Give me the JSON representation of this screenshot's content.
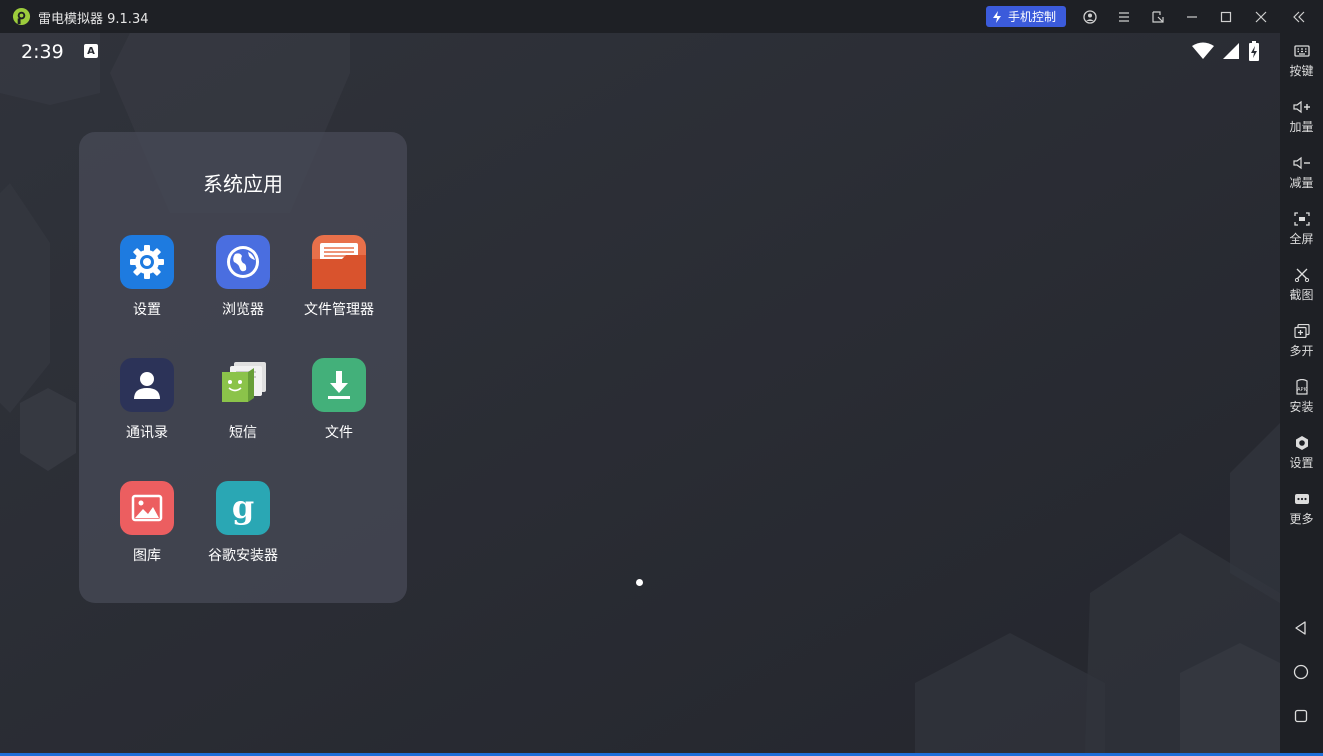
{
  "window": {
    "title": "雷电模拟器 9.1.34",
    "phone_control": "手机控制",
    "accent": "#3b5bdb"
  },
  "status_bar": {
    "time": "2:39",
    "keyboard_indicator": "A"
  },
  "folder": {
    "title": "系统应用",
    "apps": [
      {
        "label": "设置",
        "icon": "settings-gear-icon",
        "color": "#1e7be0"
      },
      {
        "label": "浏览器",
        "icon": "browser-globe-icon",
        "color": "#4a6ee0"
      },
      {
        "label": "文件管理器",
        "icon": "file-manager-folder-icon",
        "color": "#e0603a"
      },
      {
        "label": "通讯录",
        "icon": "contacts-person-icon",
        "color": "#2c3358"
      },
      {
        "label": "短信",
        "icon": "sms-android-icon",
        "color": "#8bc34a"
      },
      {
        "label": "文件",
        "icon": "download-file-icon",
        "color": "#43b07a"
      },
      {
        "label": "图库",
        "icon": "gallery-picture-icon",
        "color": "#ec5e60"
      },
      {
        "label": "谷歌安装器",
        "icon": "google-installer-g-icon",
        "color": "#2aa7b4"
      }
    ]
  },
  "sidebar": {
    "items": [
      {
        "label": "按键",
        "icon": "keyboard-icon"
      },
      {
        "label": "加量",
        "icon": "volume-up-icon"
      },
      {
        "label": "减量",
        "icon": "volume-down-icon"
      },
      {
        "label": "全屏",
        "icon": "fullscreen-icon"
      },
      {
        "label": "截图",
        "icon": "scissors-icon"
      },
      {
        "label": "多开",
        "icon": "multi-instance-icon"
      },
      {
        "label": "安装",
        "icon": "apk-install-icon"
      },
      {
        "label": "设置",
        "icon": "settings-icon"
      },
      {
        "label": "更多",
        "icon": "more-icon"
      }
    ]
  }
}
